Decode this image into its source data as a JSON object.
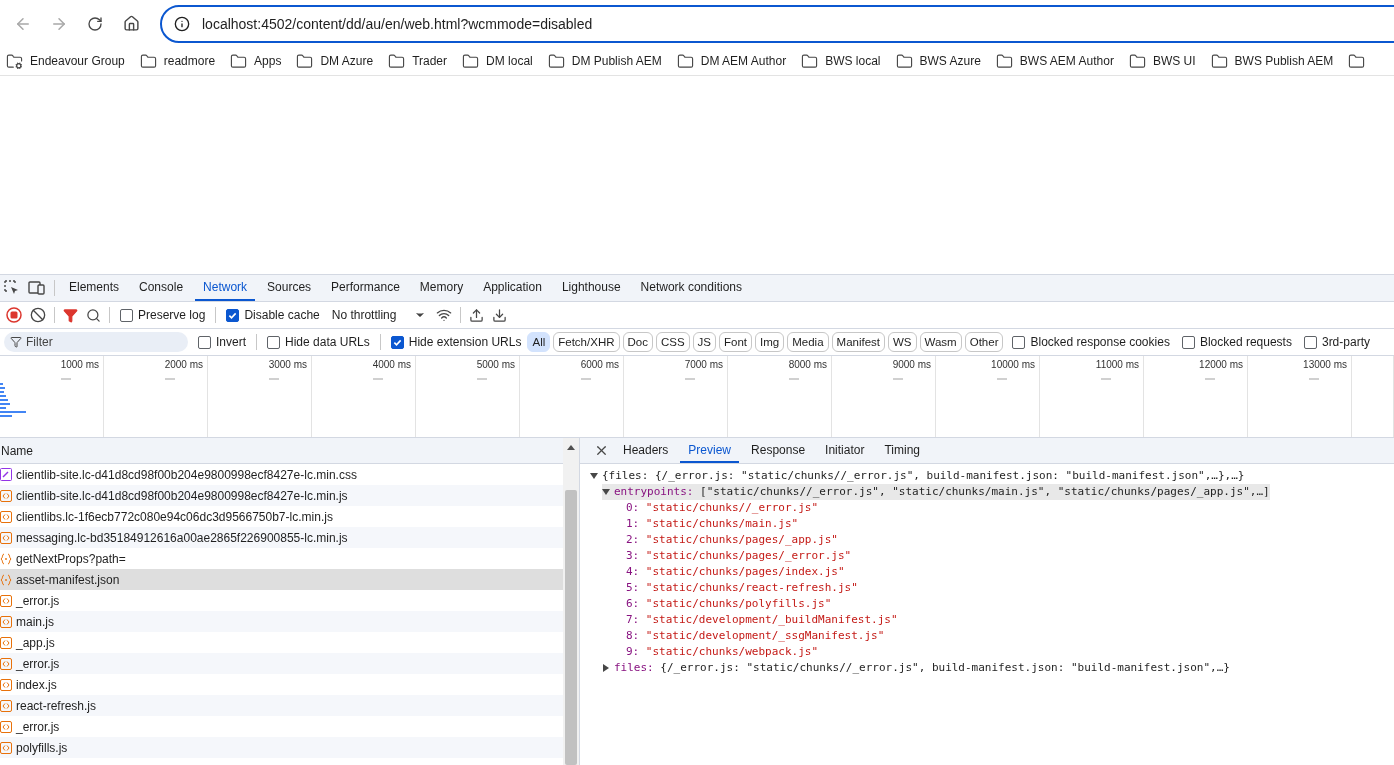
{
  "browser": {
    "back_disabled": true,
    "forward_disabled": true,
    "url": "localhost:4502/content/dd/au/en/web.html?wcmmode=disabled"
  },
  "bookmarks": [
    {
      "label": "Endeavour Group",
      "kind": "app"
    },
    {
      "label": "readmore",
      "kind": "folder"
    },
    {
      "label": "Apps",
      "kind": "folder"
    },
    {
      "label": "DM Azure",
      "kind": "folder"
    },
    {
      "label": "Trader",
      "kind": "folder"
    },
    {
      "label": "DM local",
      "kind": "folder"
    },
    {
      "label": "DM Publish AEM",
      "kind": "folder"
    },
    {
      "label": "DM AEM Author",
      "kind": "folder"
    },
    {
      "label": "BWS local",
      "kind": "folder"
    },
    {
      "label": "BWS Azure",
      "kind": "folder"
    },
    {
      "label": "BWS AEM Author",
      "kind": "folder"
    },
    {
      "label": "BWS UI",
      "kind": "folder"
    },
    {
      "label": "BWS Publish AEM",
      "kind": "folder"
    }
  ],
  "devtools": {
    "tabs": [
      {
        "label": "Elements",
        "selected": false
      },
      {
        "label": "Console",
        "selected": false
      },
      {
        "label": "Network",
        "selected": true
      },
      {
        "label": "Sources",
        "selected": false
      },
      {
        "label": "Performance",
        "selected": false
      },
      {
        "label": "Memory",
        "selected": false
      },
      {
        "label": "Application",
        "selected": false
      },
      {
        "label": "Lighthouse",
        "selected": false
      },
      {
        "label": "Network conditions",
        "selected": false
      }
    ],
    "toolbar": {
      "recording": true,
      "preserve_log": {
        "label": "Preserve log",
        "checked": false
      },
      "disable_cache": {
        "label": "Disable cache",
        "checked": true
      },
      "throttling": "No throttling"
    },
    "filter_bar": {
      "placeholder": "Filter",
      "options": [
        {
          "label": "Invert",
          "checked": false
        },
        {
          "label": "Hide data URLs",
          "checked": false
        },
        {
          "label": "Hide extension URLs",
          "checked": true
        }
      ],
      "types": [
        {
          "label": "All",
          "selected": true
        },
        {
          "label": "Fetch/XHR",
          "selected": false
        },
        {
          "label": "Doc",
          "selected": false
        },
        {
          "label": "CSS",
          "selected": false
        },
        {
          "label": "JS",
          "selected": false
        },
        {
          "label": "Font",
          "selected": false
        },
        {
          "label": "Img",
          "selected": false
        },
        {
          "label": "Media",
          "selected": false
        },
        {
          "label": "Manifest",
          "selected": false
        },
        {
          "label": "WS",
          "selected": false
        },
        {
          "label": "Wasm",
          "selected": false
        },
        {
          "label": "Other",
          "selected": false
        }
      ],
      "more_options": [
        {
          "label": "Blocked response cookies",
          "checked": false
        },
        {
          "label": "Blocked requests",
          "checked": false
        },
        {
          "label": "3rd-party",
          "checked": false
        }
      ]
    },
    "timeline": {
      "ticks": [
        "1000 ms",
        "2000 ms",
        "3000 ms",
        "4000 ms",
        "5000 ms",
        "6000 ms",
        "7000 ms",
        "8000 ms",
        "9000 ms",
        "10000 ms",
        "11000 ms",
        "12000 ms",
        "13000 ms"
      ]
    },
    "requests": {
      "column": "Name",
      "rows": [
        {
          "name": "clientlib-site.lc-d41d8cd98f00b204e9800998ecf8427e-lc.min.css",
          "kind": "css",
          "selected": false
        },
        {
          "name": "clientlib-site.lc-d41d8cd98f00b204e9800998ecf8427e-lc.min.js",
          "kind": "script",
          "selected": false
        },
        {
          "name": "clientlibs.lc-1f6ecb772c080e94c06dc3d9566750b7-lc.min.js",
          "kind": "script",
          "selected": false
        },
        {
          "name": "messaging.lc-bd35184912616a00ae2865f226900855-lc.min.js",
          "kind": "script",
          "selected": false
        },
        {
          "name": "getNextProps?path=",
          "kind": "json",
          "selected": false
        },
        {
          "name": "asset-manifest.json",
          "kind": "json",
          "selected": true
        },
        {
          "name": "_error.js",
          "kind": "script",
          "selected": false
        },
        {
          "name": "main.js",
          "kind": "script",
          "selected": false
        },
        {
          "name": "_app.js",
          "kind": "script",
          "selected": false
        },
        {
          "name": "_error.js",
          "kind": "script",
          "selected": false
        },
        {
          "name": "index.js",
          "kind": "script",
          "selected": false
        },
        {
          "name": "react-refresh.js",
          "kind": "script",
          "selected": false
        },
        {
          "name": "_error.js",
          "kind": "script",
          "selected": false
        },
        {
          "name": "polyfills.js",
          "kind": "script",
          "selected": false
        }
      ]
    },
    "detail": {
      "tabs": [
        {
          "label": "Headers",
          "selected": false
        },
        {
          "label": "Preview",
          "selected": true
        },
        {
          "label": "Response",
          "selected": false
        },
        {
          "label": "Initiator",
          "selected": false
        },
        {
          "label": "Timing",
          "selected": false
        }
      ],
      "preview": [
        {
          "text": "{files: {/_error.js: \"static/chunks//_error.js\", build-manifest.json: \"build-manifest.json\",…},…}",
          "expanded": true,
          "children": [
            {
              "key": "entrypoints:",
              "text": "[\"static/chunks//_error.js\", \"static/chunks/main.js\", \"static/chunks/pages/_app.js\",…]",
              "expanded": true,
              "highlighted": true,
              "children": [
                {
                  "key": "0:",
                  "value": "\"static/chunks//_error.js\""
                },
                {
                  "key": "1:",
                  "value": "\"static/chunks/main.js\""
                },
                {
                  "key": "2:",
                  "value": "\"static/chunks/pages/_app.js\""
                },
                {
                  "key": "3:",
                  "value": "\"static/chunks/pages/_error.js\""
                },
                {
                  "key": "4:",
                  "value": "\"static/chunks/pages/index.js\""
                },
                {
                  "key": "5:",
                  "value": "\"static/chunks/react-refresh.js\""
                },
                {
                  "key": "6:",
                  "value": "\"static/chunks/polyfills.js\""
                },
                {
                  "key": "7:",
                  "value": "\"static/development/_buildManifest.js\""
                },
                {
                  "key": "8:",
                  "value": "\"static/development/_ssgManifest.js\""
                },
                {
                  "key": "9:",
                  "value": "\"static/chunks/webpack.js\""
                }
              ]
            },
            {
              "key": "files:",
              "text": "{/_error.js: \"static/chunks//_error.js\", build-manifest.json: \"build-manifest.json\",…}",
              "expanded": false,
              "highlighted": false
            }
          ]
        }
      ]
    }
  }
}
